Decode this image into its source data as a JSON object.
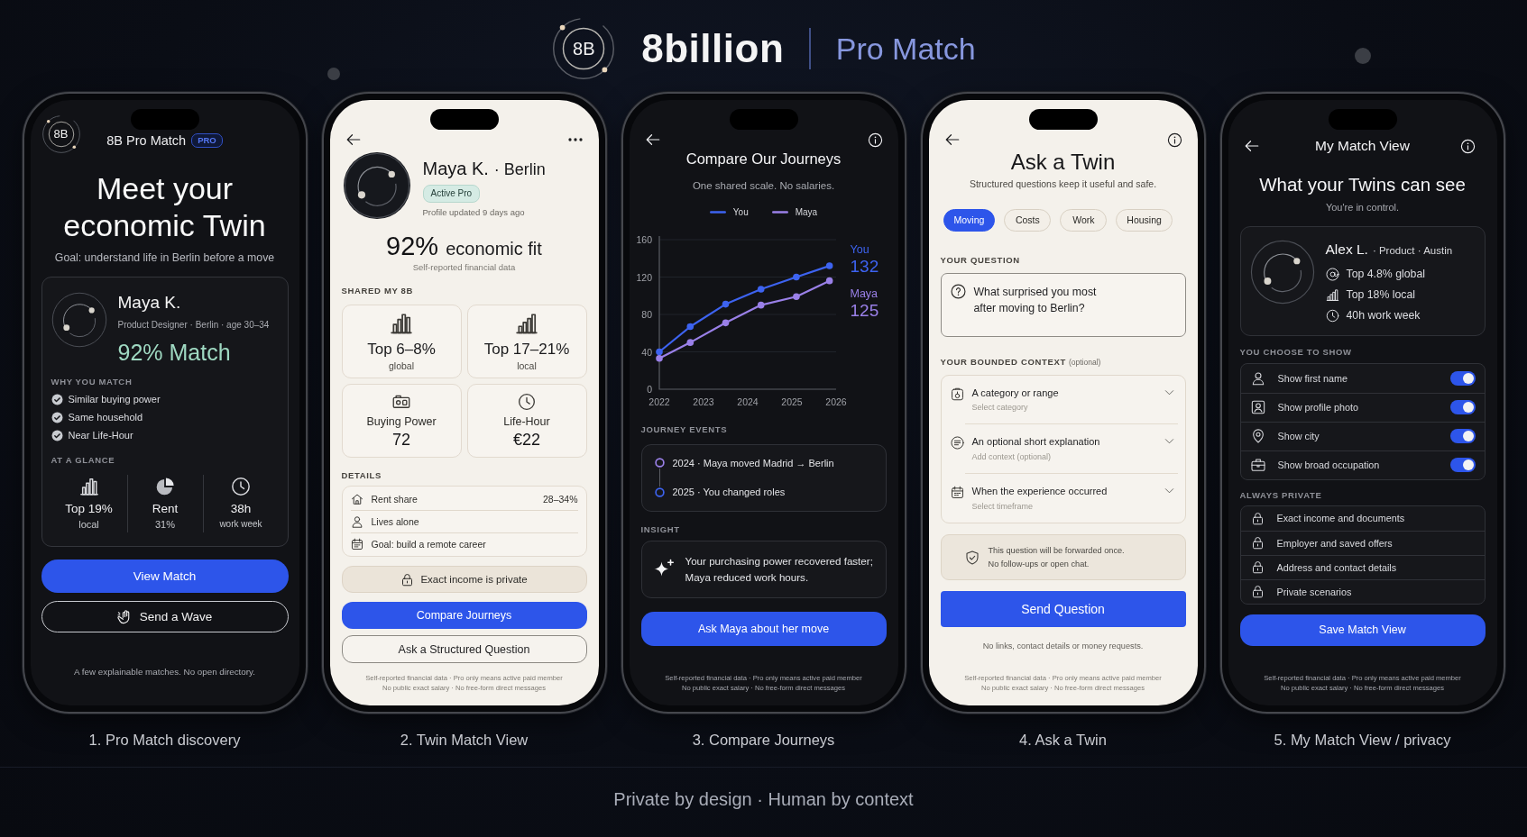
{
  "header": {
    "logo_mark": "8B",
    "brand": "8billion",
    "product": "Pro Match"
  },
  "screens": [
    {
      "kind": "discovery",
      "dark": true,
      "logo_mark": "8B",
      "app_title": "8B Pro Match",
      "badge": "PRO",
      "headline": "Meet your economic Twin",
      "goal": "Goal: understand life in Berlin before a move",
      "match": {
        "name": "Maya K.",
        "details": "Product Designer · Berlin · age 30–34",
        "score": "92% Match",
        "reasons_label": "WHY YOU MATCH",
        "reasons": [
          "Similar buying power",
          "Same household",
          "Near Life-Hour"
        ],
        "glance_label": "AT A GLANCE",
        "stats": [
          {
            "value": "Top 19%",
            "label": "local"
          },
          {
            "value": "Rent",
            "label": "31%"
          },
          {
            "value": "38h",
            "label": "work week"
          }
        ]
      },
      "primary_button": "View Match",
      "secondary_button": "Send a Wave",
      "note": "A few explainable matches. No open directory.",
      "caption": "1. Pro Match discovery"
    },
    {
      "kind": "twin_view",
      "dark": false,
      "name": "Maya K.",
      "city": "· Berlin",
      "status_badge": "Active Pro",
      "updated": "Profile updated 9 days ago",
      "fit_score": "92%",
      "fit_label": "economic fit",
      "fit_note": "Self-reported financial data",
      "shared_label": "SHARED MY 8B",
      "shared": [
        {
          "kind": "rank",
          "value": "Top 6–8%",
          "label": "global"
        },
        {
          "kind": "rank",
          "value": "Top 17–21%",
          "label": "local"
        },
        {
          "kind": "metric",
          "label": "Buying Power",
          "value": "72"
        },
        {
          "kind": "metric",
          "label": "Life-Hour",
          "value": "€22"
        }
      ],
      "details_label": "DETAILS",
      "details": [
        {
          "label": "Rent share",
          "value": "28–34%"
        },
        {
          "label": "Lives alone"
        },
        {
          "label": "Goal: build a remote career"
        }
      ],
      "privacy_note": "Exact income is private",
      "primary_button": "Compare Journeys",
      "secondary_button": "Ask a Structured Question",
      "footer": [
        "Self-reported financial data · Pro only means active paid member",
        "No public exact salary · No free-form direct messages"
      ],
      "caption": "2. Twin Match View"
    },
    {
      "kind": "compare",
      "dark": true,
      "title": "Compare Our Journeys",
      "subtitle": "One shared scale. No salaries.",
      "chart_data": {
        "type": "line",
        "grid": true,
        "x": [
          2022,
          2022.7,
          2023.5,
          2024.3,
          2025.1,
          2025.85
        ],
        "xlim": [
          2022,
          2026
        ],
        "ylim": [
          0,
          160
        ],
        "xticks": [
          2022,
          2023,
          2024,
          2025,
          2026
        ],
        "yticks": [
          0,
          40,
          80,
          120,
          160
        ],
        "series": [
          {
            "name": "You",
            "color": "#3d63f0",
            "marker": true,
            "values": [
              40,
              67,
              91,
              107,
              120,
              132
            ]
          },
          {
            "name": "Maya",
            "color": "#9a80e8",
            "marker": true,
            "values": [
              33,
              50,
              71,
              90,
              99,
              116
            ]
          }
        ]
      },
      "end_labels": [
        {
          "name": "You",
          "value": "132"
        },
        {
          "name": "Maya",
          "value": "125"
        }
      ],
      "events_label": "JOURNEY EVENTS",
      "events": [
        {
          "text": "2024 · Maya moved Madrid → Berlin",
          "color": "#9a80e8"
        },
        {
          "text": "2025 · You changed roles",
          "color": "#3d63f0"
        }
      ],
      "insight_label": "INSIGHT",
      "insight": "Your purchasing power recovered faster; Maya reduced work hours.",
      "primary_button": "Ask Maya about her move",
      "footer": [
        "Self-reported financial data · Pro only means active paid member",
        "No public exact salary · No free-form direct messages"
      ],
      "caption": "3. Compare Journeys"
    },
    {
      "kind": "ask",
      "dark": false,
      "title": "Ask a Twin",
      "subtitle": "Structured questions keep it useful and safe.",
      "topics": [
        {
          "label": "Moving",
          "selected": true
        },
        {
          "label": "Costs",
          "selected": false
        },
        {
          "label": "Work",
          "selected": false
        },
        {
          "label": "Housing",
          "selected": false
        }
      ],
      "question_label": "YOUR QUESTION",
      "question": {
        "value": "What surprised you most after moving to Berlin?"
      },
      "context_label": "YOUR BOUNDED CONTEXT",
      "context_hint": "(optional)",
      "context_fields": [
        {
          "label": "A category or range",
          "placeholder": "Select category"
        },
        {
          "label": "An optional short explanation",
          "placeholder": "Add context (optional)"
        },
        {
          "label": "When the experience occurred",
          "placeholder": "Select timeframe"
        }
      ],
      "notice": [
        "This question will be forwarded once.",
        "No follow-ups or open chat."
      ],
      "primary_button": "Send Question",
      "rules": "No links, contact details or money requests.",
      "footer": [
        "Self-reported financial data · Pro only means active paid member",
        "No public exact salary · No free-form direct messages"
      ],
      "caption": "4. Ask a Twin"
    },
    {
      "kind": "privacy",
      "dark": true,
      "title": "My Match View",
      "headline": "What your Twins can see",
      "subtitle": "You're in control.",
      "profile": {
        "name": "Alex L.",
        "details": "· Product · Austin",
        "stats": [
          "Top 4.8% global",
          "Top 18% local",
          "40h work week"
        ]
      },
      "show_label": "YOU CHOOSE TO SHOW",
      "show": [
        {
          "label": "Show first name",
          "on": true
        },
        {
          "label": "Show profile photo",
          "on": true
        },
        {
          "label": "Show city",
          "on": true
        },
        {
          "label": "Show broad occupation",
          "on": true
        }
      ],
      "private_label": "ALWAYS PRIVATE",
      "private": [
        "Exact income and documents",
        "Employer and saved offers",
        "Address and contact details",
        "Private scenarios"
      ],
      "primary_button": "Save Match View",
      "footer": [
        "Self-reported financial data · Pro only means active paid member",
        "No public exact salary · No free-form direct messages"
      ],
      "caption": "5. My Match View / privacy"
    }
  ],
  "tagline": "Private by design · Human by context"
}
